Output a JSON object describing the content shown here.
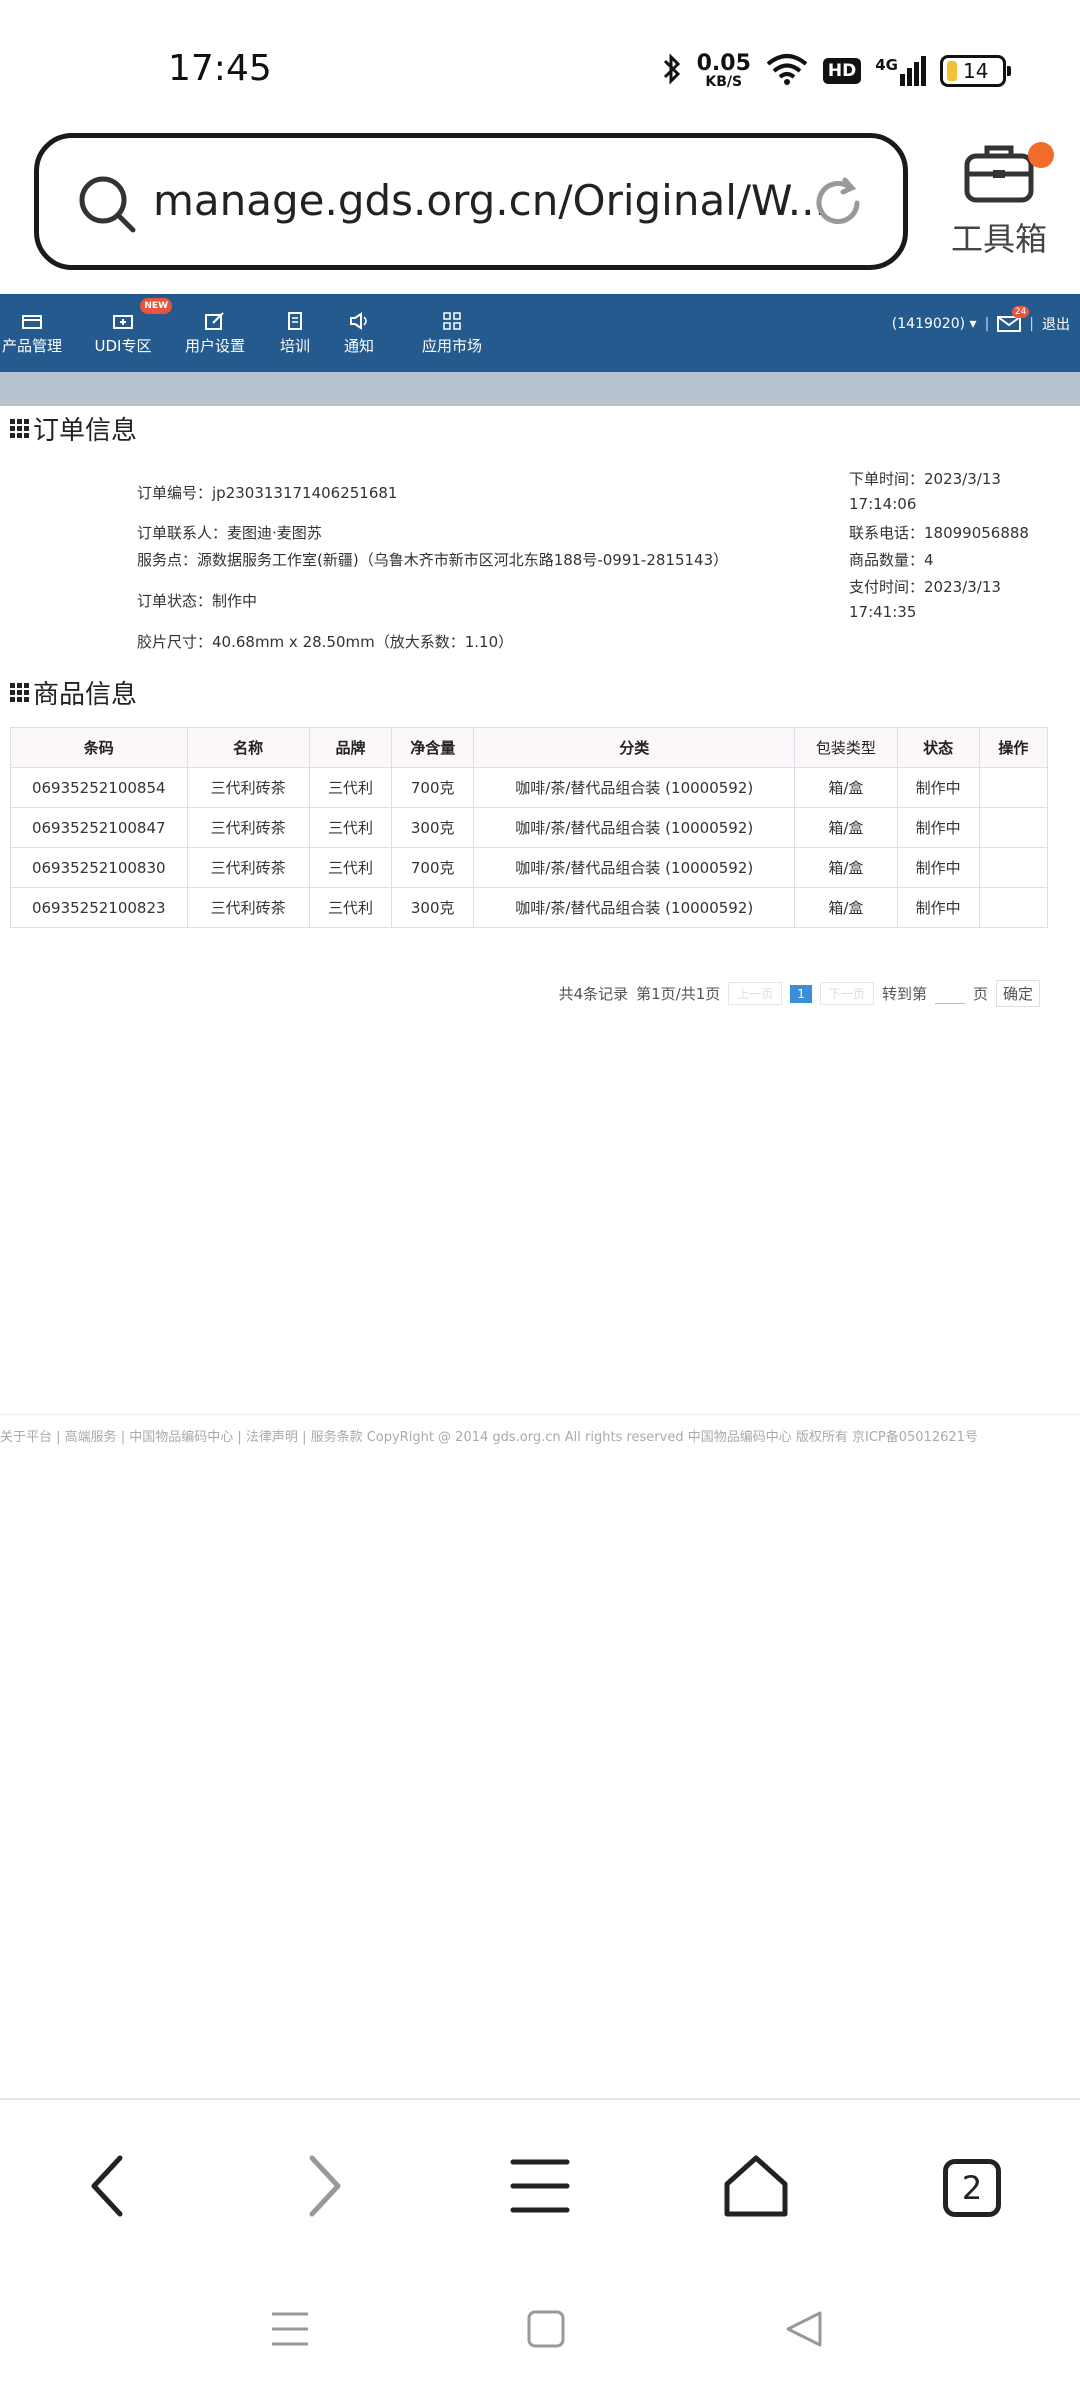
{
  "status": {
    "time": "17:45",
    "net_speed": "0.05",
    "net_unit": "KB/S",
    "hd": "HD",
    "net_type": "4G",
    "battery": "14"
  },
  "browser": {
    "url": "manage.gds.org.cn/Original/W...",
    "toolbox_label": "工具箱",
    "tab_count": "2"
  },
  "nav": {
    "items": [
      {
        "label": "产品管理"
      },
      {
        "label": "UDI专区",
        "badge": "NEW"
      },
      {
        "label": "用户设置"
      },
      {
        "label": "培训"
      },
      {
        "label": "通知"
      },
      {
        "label": "应用市场"
      }
    ],
    "account": "(1419020)",
    "mail_badge": "24",
    "logout": "退出"
  },
  "order": {
    "title": "订单信息",
    "number": "订单编号：jp230313171406251681",
    "contact": "订单联系人：麦图迪·麦图苏",
    "service": "服务点：源数据服务工作室(新疆)（乌鲁木齐市新市区河北东路188号-0991-2815143）",
    "status": "订单状态：制作中",
    "film_size": "胶片尺寸：40.68mm x 28.50mm（放大系数：1.10）",
    "order_time_label": "下单时间：2023/3/13",
    "order_time_clock": "17:14:06",
    "phone": "联系电话：18099056888",
    "quantity": "商品数量：4",
    "pay_time_label": "支付时间：2023/3/13",
    "pay_time_clock": "17:41:35"
  },
  "goods": {
    "title": "商品信息",
    "headers": [
      "条码",
      "名称",
      "品牌",
      "净含量",
      "分类",
      "包装类型",
      "状态",
      "操作"
    ],
    "rows": [
      [
        "06935252100854",
        "三代利砖茶",
        "三代利",
        "700克",
        "咖啡/茶/替代品组合装 (10000592)",
        "箱/盒",
        "制作中",
        ""
      ],
      [
        "06935252100847",
        "三代利砖茶",
        "三代利",
        "300克",
        "咖啡/茶/替代品组合装 (10000592)",
        "箱/盒",
        "制作中",
        ""
      ],
      [
        "06935252100830",
        "三代利砖茶",
        "三代利",
        "700克",
        "咖啡/茶/替代品组合装 (10000592)",
        "箱/盒",
        "制作中",
        ""
      ],
      [
        "06935252100823",
        "三代利砖茶",
        "三代利",
        "300克",
        "咖啡/茶/替代品组合装 (10000592)",
        "箱/盒",
        "制作中",
        ""
      ]
    ]
  },
  "pager": {
    "total": "共4条记录",
    "page_info": "第1页/共1页",
    "prev": "上一页",
    "current": "1",
    "next": "下一页",
    "goto": "转到第",
    "page_unit": "页",
    "confirm": "确定"
  },
  "footer": {
    "text": "关于平台 | 高端服务 | 中国物品编码中心 | 法律声明 | 服务条款 CopyRight @ 2014 gds.org.cn All rights reserved 中国物品编码中心 版权所有 京ICP备05012621号"
  }
}
